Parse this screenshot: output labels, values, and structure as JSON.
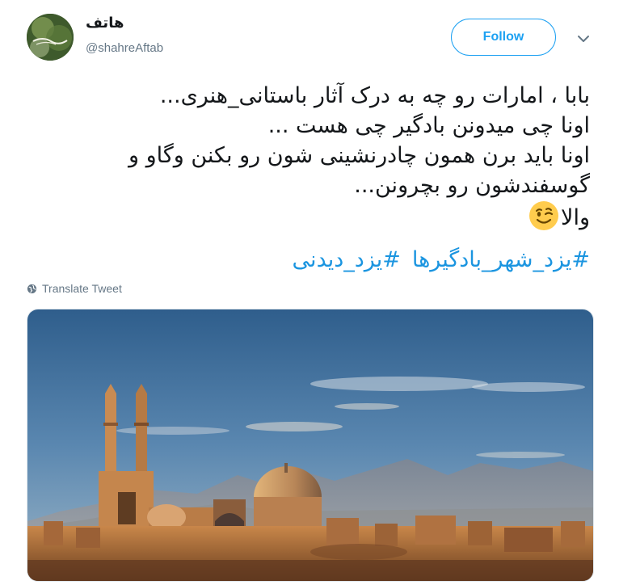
{
  "tweet": {
    "author": {
      "display_name": "هاتف",
      "handle": "@shahreAftab"
    },
    "follow_label": "Follow",
    "text_lines": [
      "بابا ، امارات رو چه به درک آثار باستانی_هنری...",
      "اونا چی میدونن بادگیر چی هست ...",
      "اونا باید برن همون چادرنشینی شون رو بکنن وگاو و",
      "گوسفندشون رو بچرونن...",
      "والا"
    ],
    "hashtags": [
      "#یزد_شهر_بادگیرها",
      "#یزد_دیدنی"
    ],
    "translate_label": "Translate Tweet",
    "emoji": "winking-face",
    "colors": {
      "accent": "#1da1f2",
      "hashtag": "#1b95e0",
      "muted": "#657786"
    }
  }
}
